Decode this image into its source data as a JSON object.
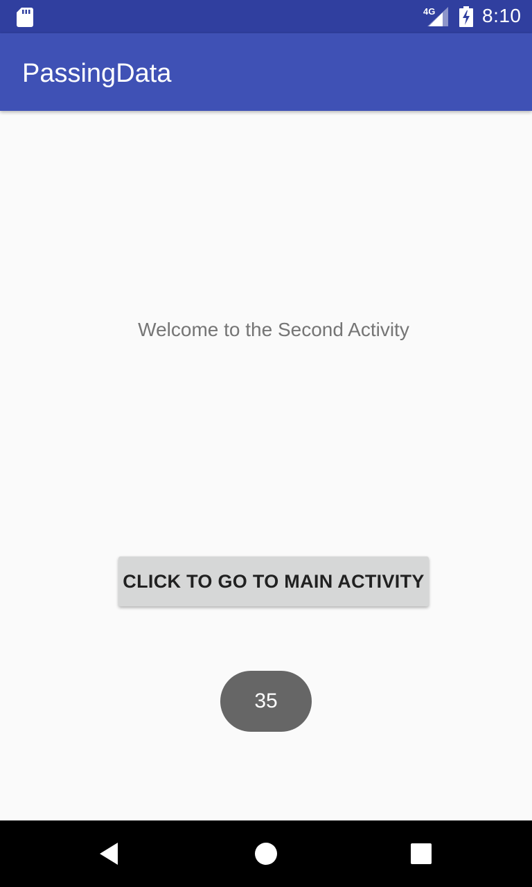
{
  "status_bar": {
    "time": "8:10",
    "network": "4G",
    "icons": [
      "sd-card-icon",
      "signal-icon",
      "battery-charging-icon"
    ]
  },
  "app_bar": {
    "title": "PassingData",
    "color": "#3f51b5"
  },
  "content": {
    "welcome_text": "Welcome to the Second Activity",
    "button_label": "CLICK TO GO TO MAIN ACTIVITY",
    "toast_text": "35"
  },
  "nav_bar": {
    "buttons": [
      "back-icon",
      "home-icon",
      "recents-icon"
    ]
  }
}
